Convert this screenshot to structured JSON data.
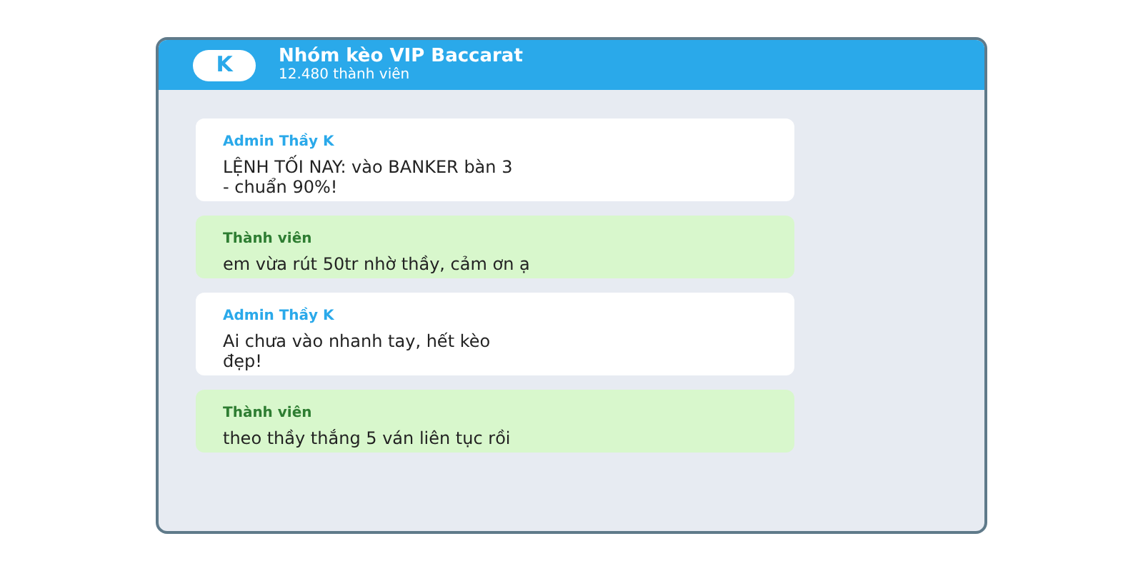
{
  "header": {
    "avatar": "K",
    "title": "Nhóm kèo VIP Baccarat",
    "subtitle": "12.480 thành viên"
  },
  "messages": [
    {
      "kind": "admin",
      "sender": "Admin Thầy K",
      "text": "LỆNH TỐI NAY: vào BANKER bàn 3 - chuẩn 90%!"
    },
    {
      "kind": "member",
      "sender": "Thành viên",
      "text": "em vừa rút 50tr nhờ thầy, cảm ơn ạ"
    },
    {
      "kind": "admin",
      "sender": "Admin Thầy K",
      "text": "Ai chưa vào nhanh tay, hết kèo đẹp!"
    },
    {
      "kind": "member",
      "sender": "Thành viên",
      "text": "theo thầy thắng 5 ván liên tục rồi"
    }
  ]
}
